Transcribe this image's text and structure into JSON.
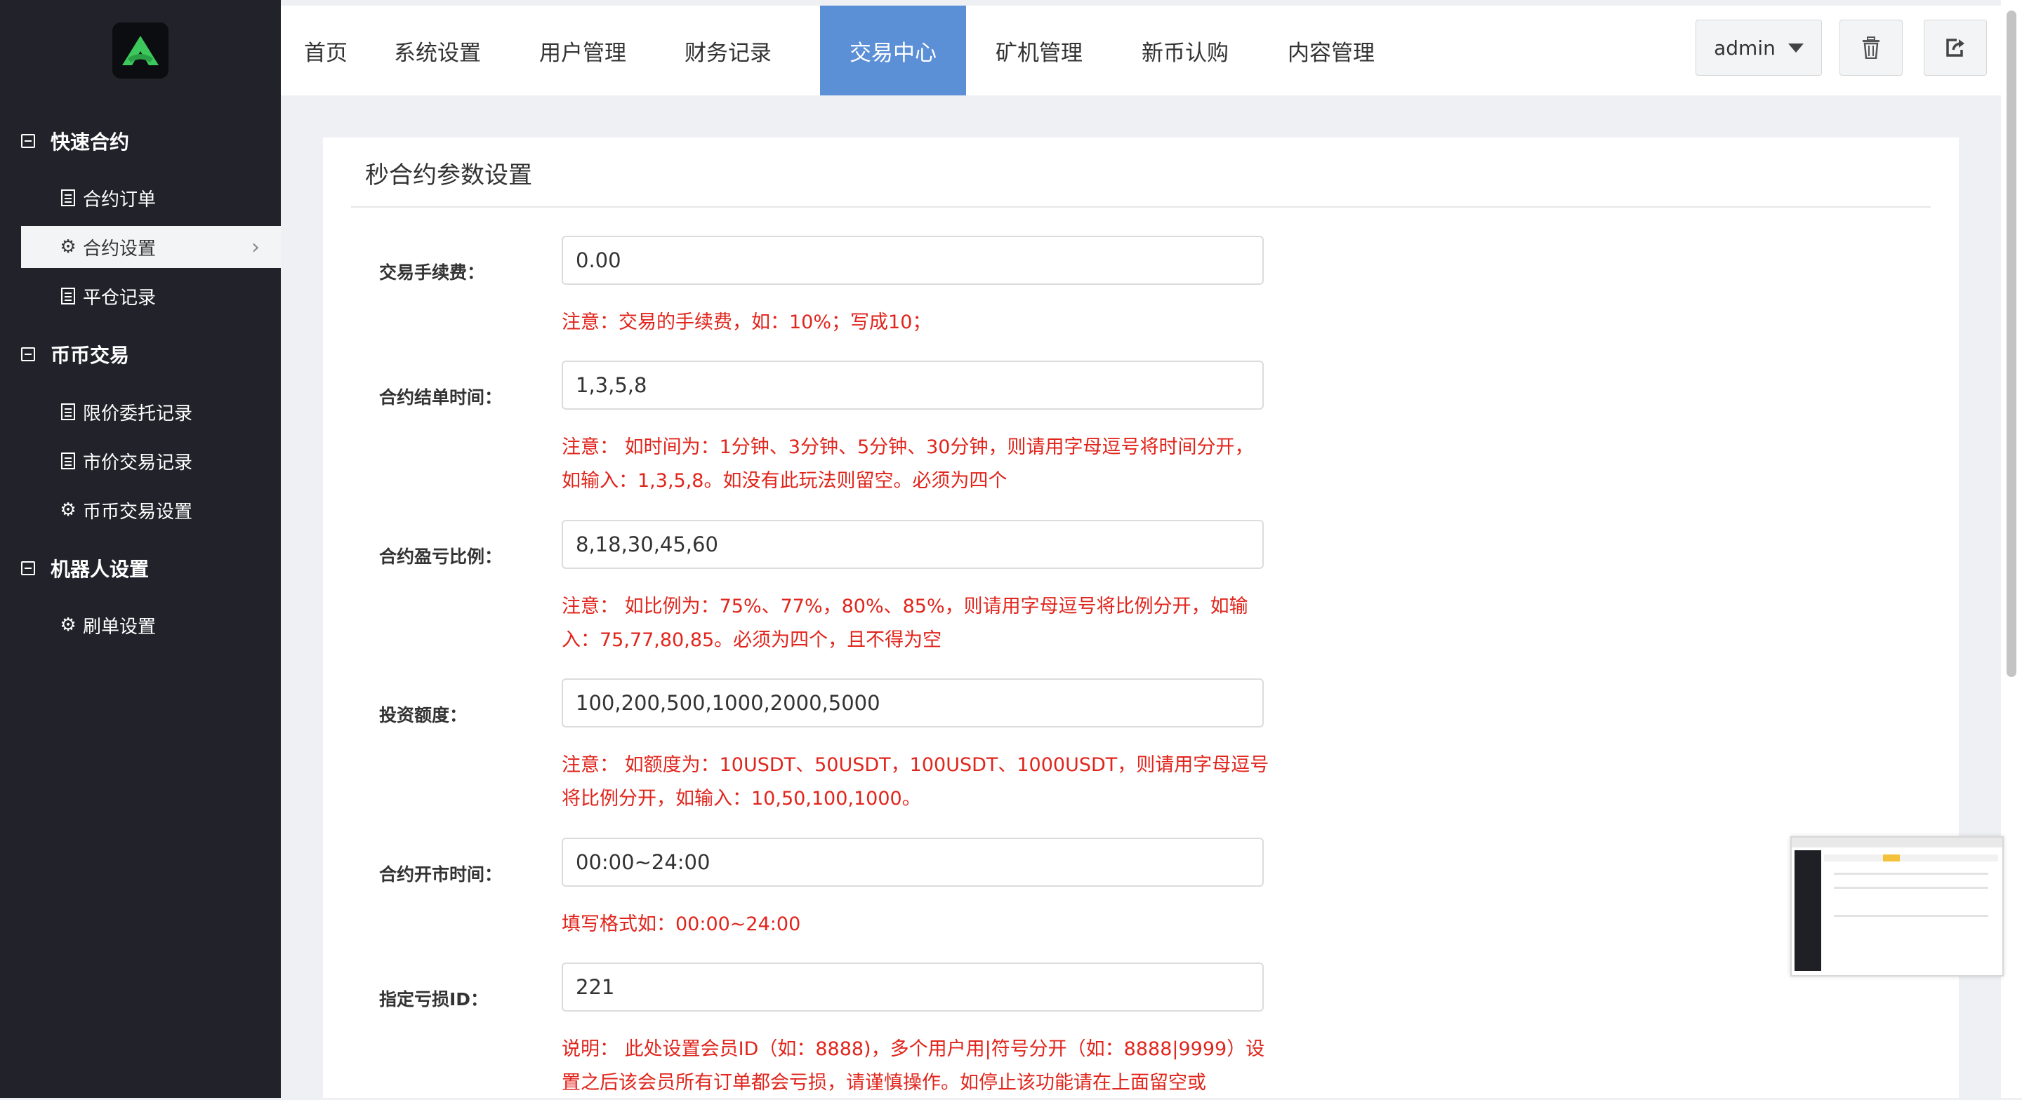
{
  "colors": {
    "sidebar_bg": "#22232a",
    "active_tab": "#5b8fd6",
    "note_red": "#e0251c",
    "logo_green": "#3cc85a"
  },
  "sidebar": {
    "logo_icon": "logo-icon",
    "groups": [
      {
        "title": "快速合约",
        "items": [
          {
            "label": "合约订单",
            "icon": "list-icon"
          },
          {
            "label": "合约设置",
            "icon": "gear-icon",
            "active": true
          },
          {
            "label": "平仓记录",
            "icon": "list-icon"
          }
        ]
      },
      {
        "title": "币币交易",
        "items": [
          {
            "label": "限价委托记录",
            "icon": "list-icon"
          },
          {
            "label": "市价交易记录",
            "icon": "list-icon"
          },
          {
            "label": "币币交易设置",
            "icon": "gear-icon"
          }
        ]
      },
      {
        "title": "机器人设置",
        "items": [
          {
            "label": "刷单设置",
            "icon": "gear-icon"
          }
        ]
      }
    ]
  },
  "topnav": {
    "tabs": [
      "首页",
      "系统设置",
      "用户管理",
      "财务记录",
      "交易中心",
      "矿机管理",
      "新币认购",
      "内容管理"
    ],
    "active_tab": "交易中心",
    "user": "admin",
    "trash_icon": "trash-icon",
    "logout_icon": "logout-icon"
  },
  "panel": {
    "title": "秒合约参数设置",
    "fields": [
      {
        "label": "交易手续费：",
        "value": "0.00",
        "note": "注意：交易的手续费，如：10%；写成10；"
      },
      {
        "label": "合约结单时间：",
        "value": "1,3,5,8",
        "note": "注意： 如时间为：1分钟、3分钟、5分钟、30分钟，则请用字母逗号将时间分开，如输入：1,3,5,8。如没有此玩法则留空。必须为四个"
      },
      {
        "label": "合约盈亏比例：",
        "value": "8,18,30,45,60",
        "note": "注意： 如比例为：75%、77%，80%、85%，则请用字母逗号将比例分开，如输入：75,77,80,85。必须为四个，且不得为空"
      },
      {
        "label": "投资额度：",
        "value": "100,200,500,1000,2000,5000",
        "note": "注意： 如额度为：10USDT、50USDT，100USDT、1000USDT，则请用字母逗号将比例分开，如输入：10,50,100,1000。"
      },
      {
        "label": "合约开市时间：",
        "value": "00:00~24:00",
        "note": "填写格式如：00:00~24:00"
      },
      {
        "label": "指定亏损ID：",
        "value": "221",
        "note": "说明： 此处设置会员ID（如：8888)，多个用户用|符号分开（如：8888|9999）设置之后该会员所有订单都会亏损，请谨慎操作。如停止该功能请在上面留空或"
      }
    ]
  }
}
